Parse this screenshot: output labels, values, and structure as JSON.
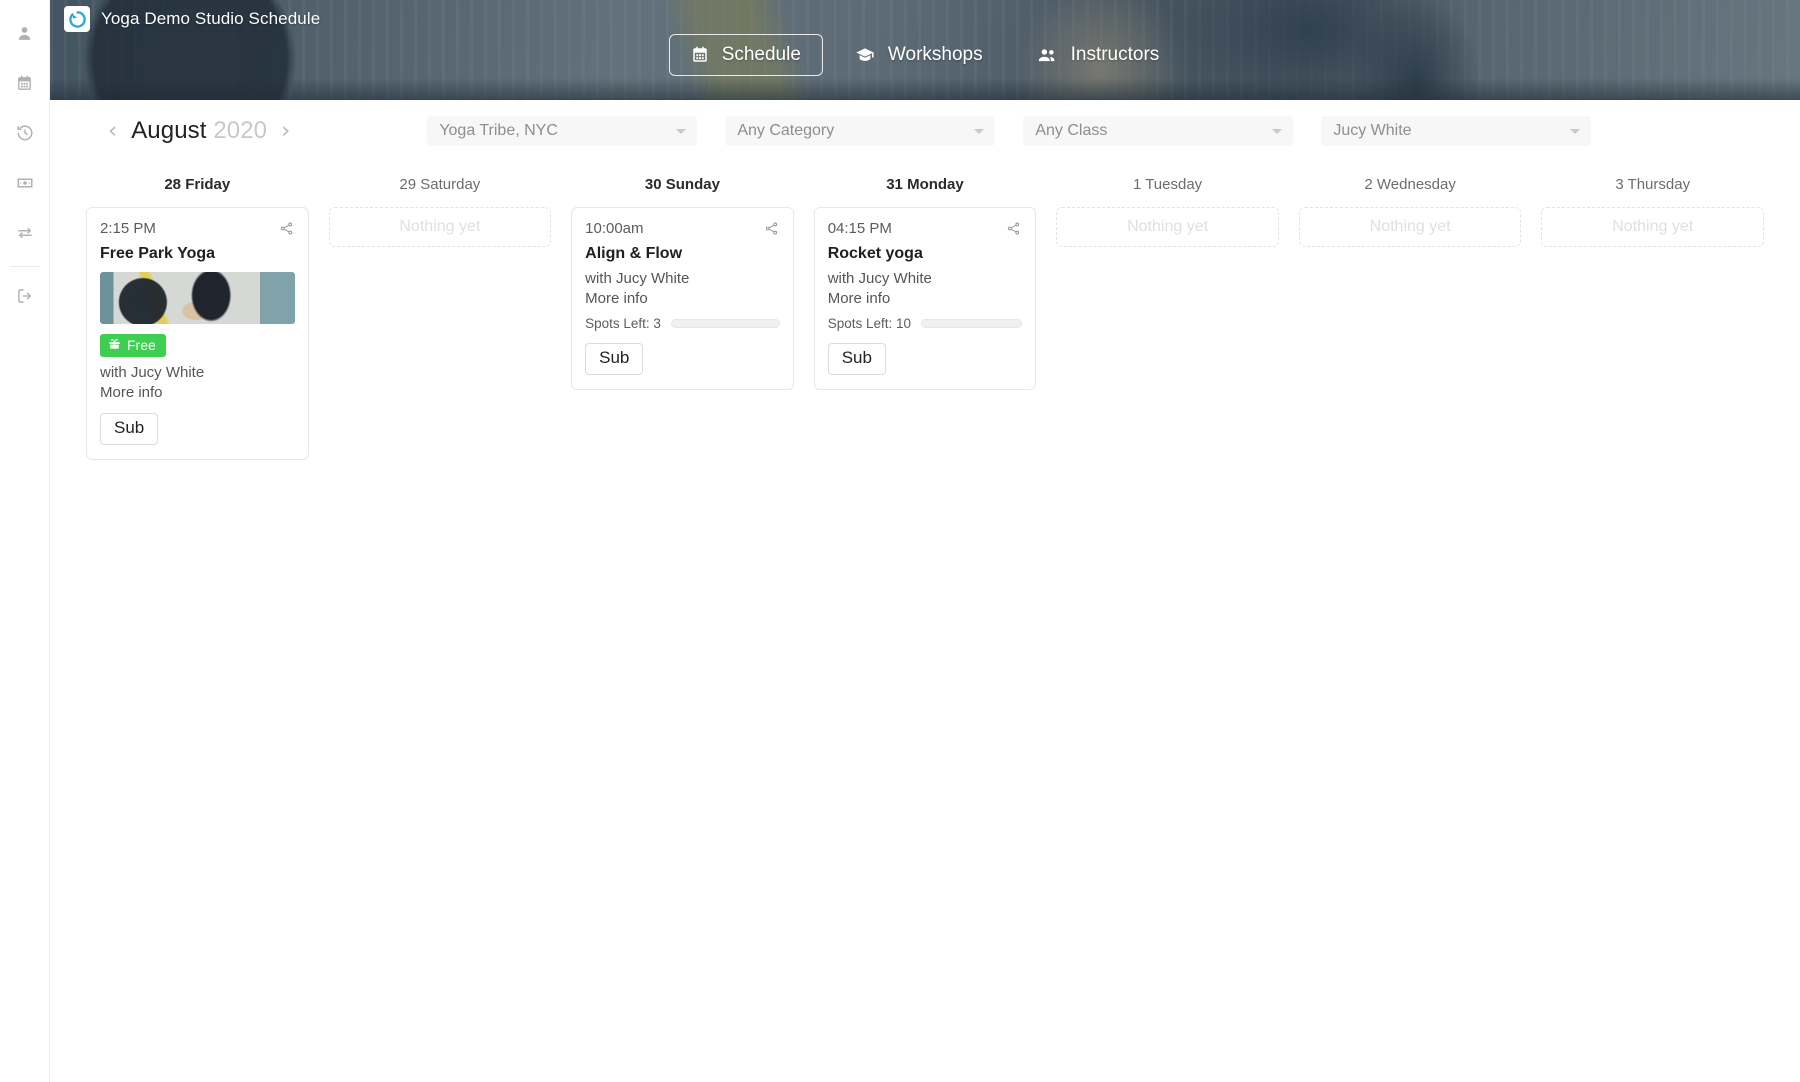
{
  "brand": {
    "title": "Yoga Demo Studio Schedule",
    "logo_icon": "circular-arrow-logo-icon"
  },
  "nav": {
    "items": [
      {
        "label": "Schedule",
        "icon": "calendar-icon",
        "active": true
      },
      {
        "label": "Workshops",
        "icon": "graduation-cap-icon",
        "active": false
      },
      {
        "label": "Instructors",
        "icon": "people-icon",
        "active": false
      }
    ]
  },
  "sidebar": {
    "items": [
      {
        "name": "profile",
        "icon": "user-icon"
      },
      {
        "name": "schedule",
        "icon": "calendar-icon"
      },
      {
        "name": "history",
        "icon": "history-clock-icon"
      },
      {
        "name": "payments",
        "icon": "banknote-icon"
      },
      {
        "name": "transfers",
        "icon": "exchange-arrows-icon"
      },
      {
        "name": "logout",
        "icon": "logout-icon"
      }
    ]
  },
  "toolbar": {
    "prev_icon": "chevron-left-icon",
    "next_icon": "chevron-right-icon",
    "month": "August",
    "year": "2020",
    "filters": [
      {
        "name": "studio",
        "value": "Yoga Tribe, NYC"
      },
      {
        "name": "category",
        "value": "Any Category"
      },
      {
        "name": "class",
        "value": "Any Class"
      },
      {
        "name": "instructor",
        "value": "Jucy White"
      }
    ]
  },
  "empty_label": "Nothing yet",
  "colors": {
    "free_badge": "#3ecf52",
    "accent": "#1e9ad6"
  },
  "days": [
    {
      "label": "28 Friday",
      "has_events": true,
      "events": [
        {
          "time": "2:15 PM",
          "title": "Free Park Yoga",
          "has_photo": true,
          "badge": "Free",
          "badge_icon": "gift-icon",
          "instructor": "with Jucy White",
          "more_info": "More info",
          "spots": null,
          "sub_label": "Sub",
          "share_icon": "share-icon"
        }
      ]
    },
    {
      "label": "29 Saturday",
      "has_events": false,
      "events": []
    },
    {
      "label": "30 Sunday",
      "has_events": true,
      "events": [
        {
          "time": "10:00am",
          "title": "Align & Flow",
          "has_photo": false,
          "badge": null,
          "badge_icon": null,
          "instructor": "with Jucy White",
          "more_info": "More info",
          "spots": "Spots Left: 3",
          "sub_label": "Sub",
          "share_icon": "share-icon"
        }
      ]
    },
    {
      "label": "31 Monday",
      "has_events": true,
      "events": [
        {
          "time": "04:15 PM",
          "title": "Rocket yoga",
          "has_photo": false,
          "badge": null,
          "badge_icon": null,
          "instructor": "with Jucy White",
          "more_info": "More info",
          "spots": "Spots Left: 10",
          "sub_label": "Sub",
          "share_icon": "share-icon"
        }
      ]
    },
    {
      "label": "1 Tuesday",
      "has_events": false,
      "events": []
    },
    {
      "label": "2 Wednesday",
      "has_events": false,
      "events": []
    },
    {
      "label": "3 Thursday",
      "has_events": false,
      "events": []
    }
  ]
}
